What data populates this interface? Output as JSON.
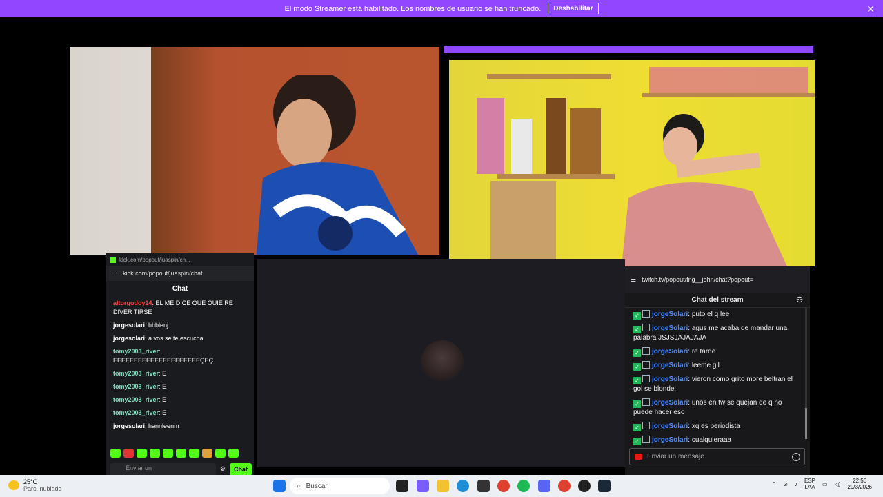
{
  "banner": {
    "text": "El modo Streamer está habilitado. Los nombres de usuario se han truncado.",
    "button": "Deshabilitar",
    "close": "✕"
  },
  "kick": {
    "tab_title": "kick.com/popout/juaspin/ch...",
    "url": "kick.com/popout/juaspin/chat",
    "header": "Chat",
    "messages": [
      {
        "user": "altorgodoy14",
        "text": "ÉL ME DICE QUE QUIE RE DIVER TIRSE",
        "color": "#ff4040"
      },
      {
        "user": "jorgesolari",
        "text": "hbblenj",
        "color": "#e6e6e6"
      },
      {
        "user": "jorgesolari",
        "text": "a vos se te escucha",
        "color": "#e6e6e6"
      },
      {
        "user": "tomy2003_river",
        "text": "EEEEEEEEEEEEEEEEEEEEEÇEÇ",
        "color": "#7fe0c0"
      },
      {
        "user": "tomy2003_river",
        "text": "E",
        "color": "#7fe0c0"
      },
      {
        "user": "tomy2003_river",
        "text": "E",
        "color": "#7fe0c0"
      },
      {
        "user": "tomy2003_river",
        "text": "E",
        "color": "#7fe0c0"
      },
      {
        "user": "tomy2003_river",
        "text": "E",
        "color": "#7fe0c0"
      },
      {
        "user": "jorgesolari",
        "text": "hannleenm",
        "color": "#e6e6e6"
      }
    ],
    "input_placeholder": "Enviar un",
    "send_label": "Chat"
  },
  "twitch": {
    "url": "twitch.tv/popout/fng__john/chat?popout=",
    "header": "Chat del stream",
    "messages": [
      {
        "user": "jorgeSolari",
        "text": "puto el q lee"
      },
      {
        "user": "jorgeSolari",
        "text": "agus me acaba de mandar una palabra JSJSJAJAJAJA"
      },
      {
        "user": "jorgeSolari",
        "text": "re tarde"
      },
      {
        "user": "jorgeSolari",
        "text": "leeme gil"
      },
      {
        "user": "jorgeSolari",
        "text": "vieron como grito more beltran el gol se blondel"
      },
      {
        "user": "jorgeSolari",
        "text": "unos en tw se quejan de q no puede hacer eso"
      },
      {
        "user": "jorgeSolari",
        "text": "xq es periodista"
      },
      {
        "user": "jorgeSolari",
        "text": "cualquieraaa"
      }
    ],
    "input_placeholder": "Enviar un mensaje"
  },
  "taskbar": {
    "temp": "25°C",
    "weather": "Parc. nublado",
    "search": "Buscar",
    "lang1": "ESP",
    "lang2": "LAA",
    "time": "22:56",
    "date": "29/3/2026"
  }
}
